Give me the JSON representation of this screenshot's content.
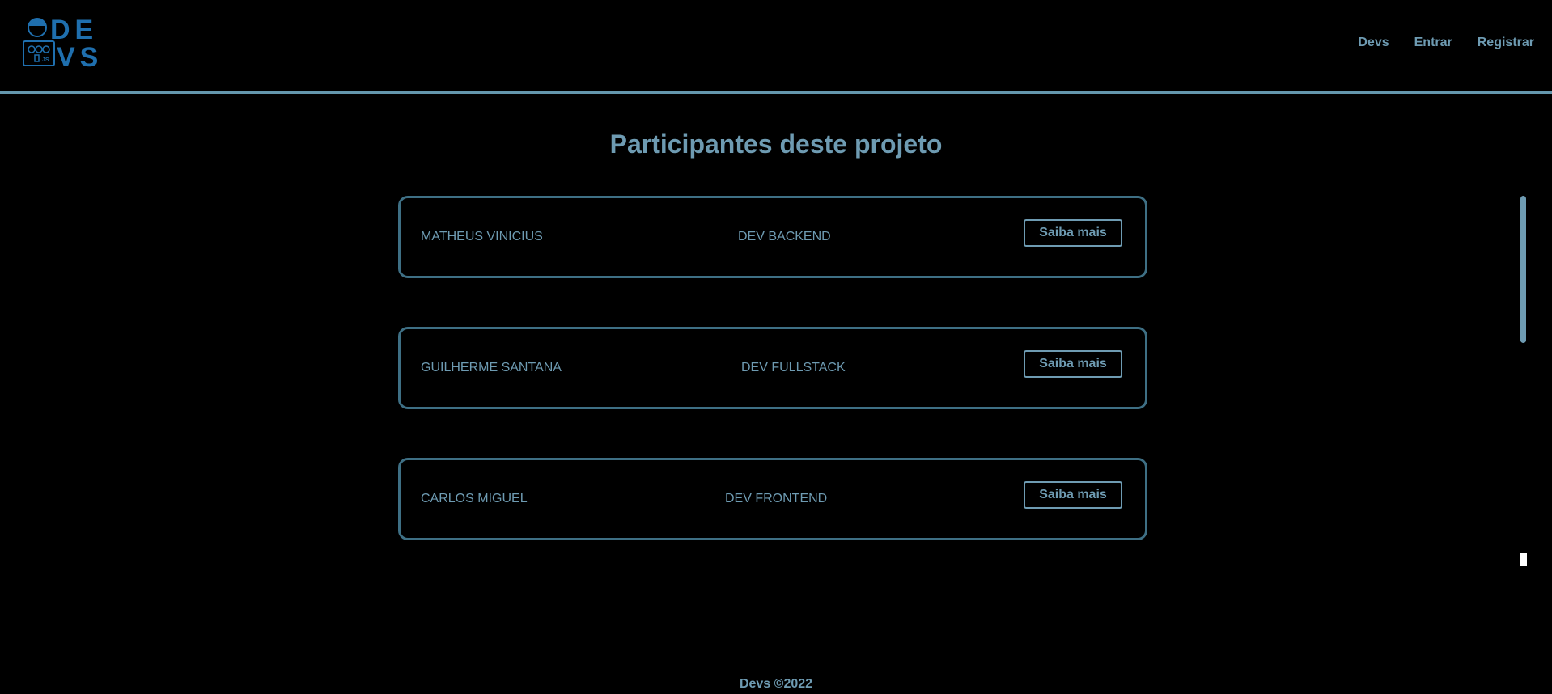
{
  "brand": {
    "logo_text_top": "DE",
    "logo_text_bottom": "VS",
    "accent_color": "#6497ad",
    "logo_color": "#1f6fae"
  },
  "nav": {
    "items": [
      {
        "label": "Devs"
      },
      {
        "label": "Entrar"
      },
      {
        "label": "Registrar"
      }
    ]
  },
  "main": {
    "title": "Participantes deste projeto",
    "members": [
      {
        "name": "MATHEUS VINICIUS",
        "role": "DEV BACKEND",
        "button_label": "Saiba mais"
      },
      {
        "name": "GUILHERME SANTANA",
        "role": "DEV FULLSTACK",
        "button_label": "Saiba mais"
      },
      {
        "name": "CARLOS MIGUEL",
        "role": "DEV FRONTEND",
        "button_label": "Saiba mais"
      }
    ]
  },
  "footer": {
    "text": "Devs ©2022"
  }
}
